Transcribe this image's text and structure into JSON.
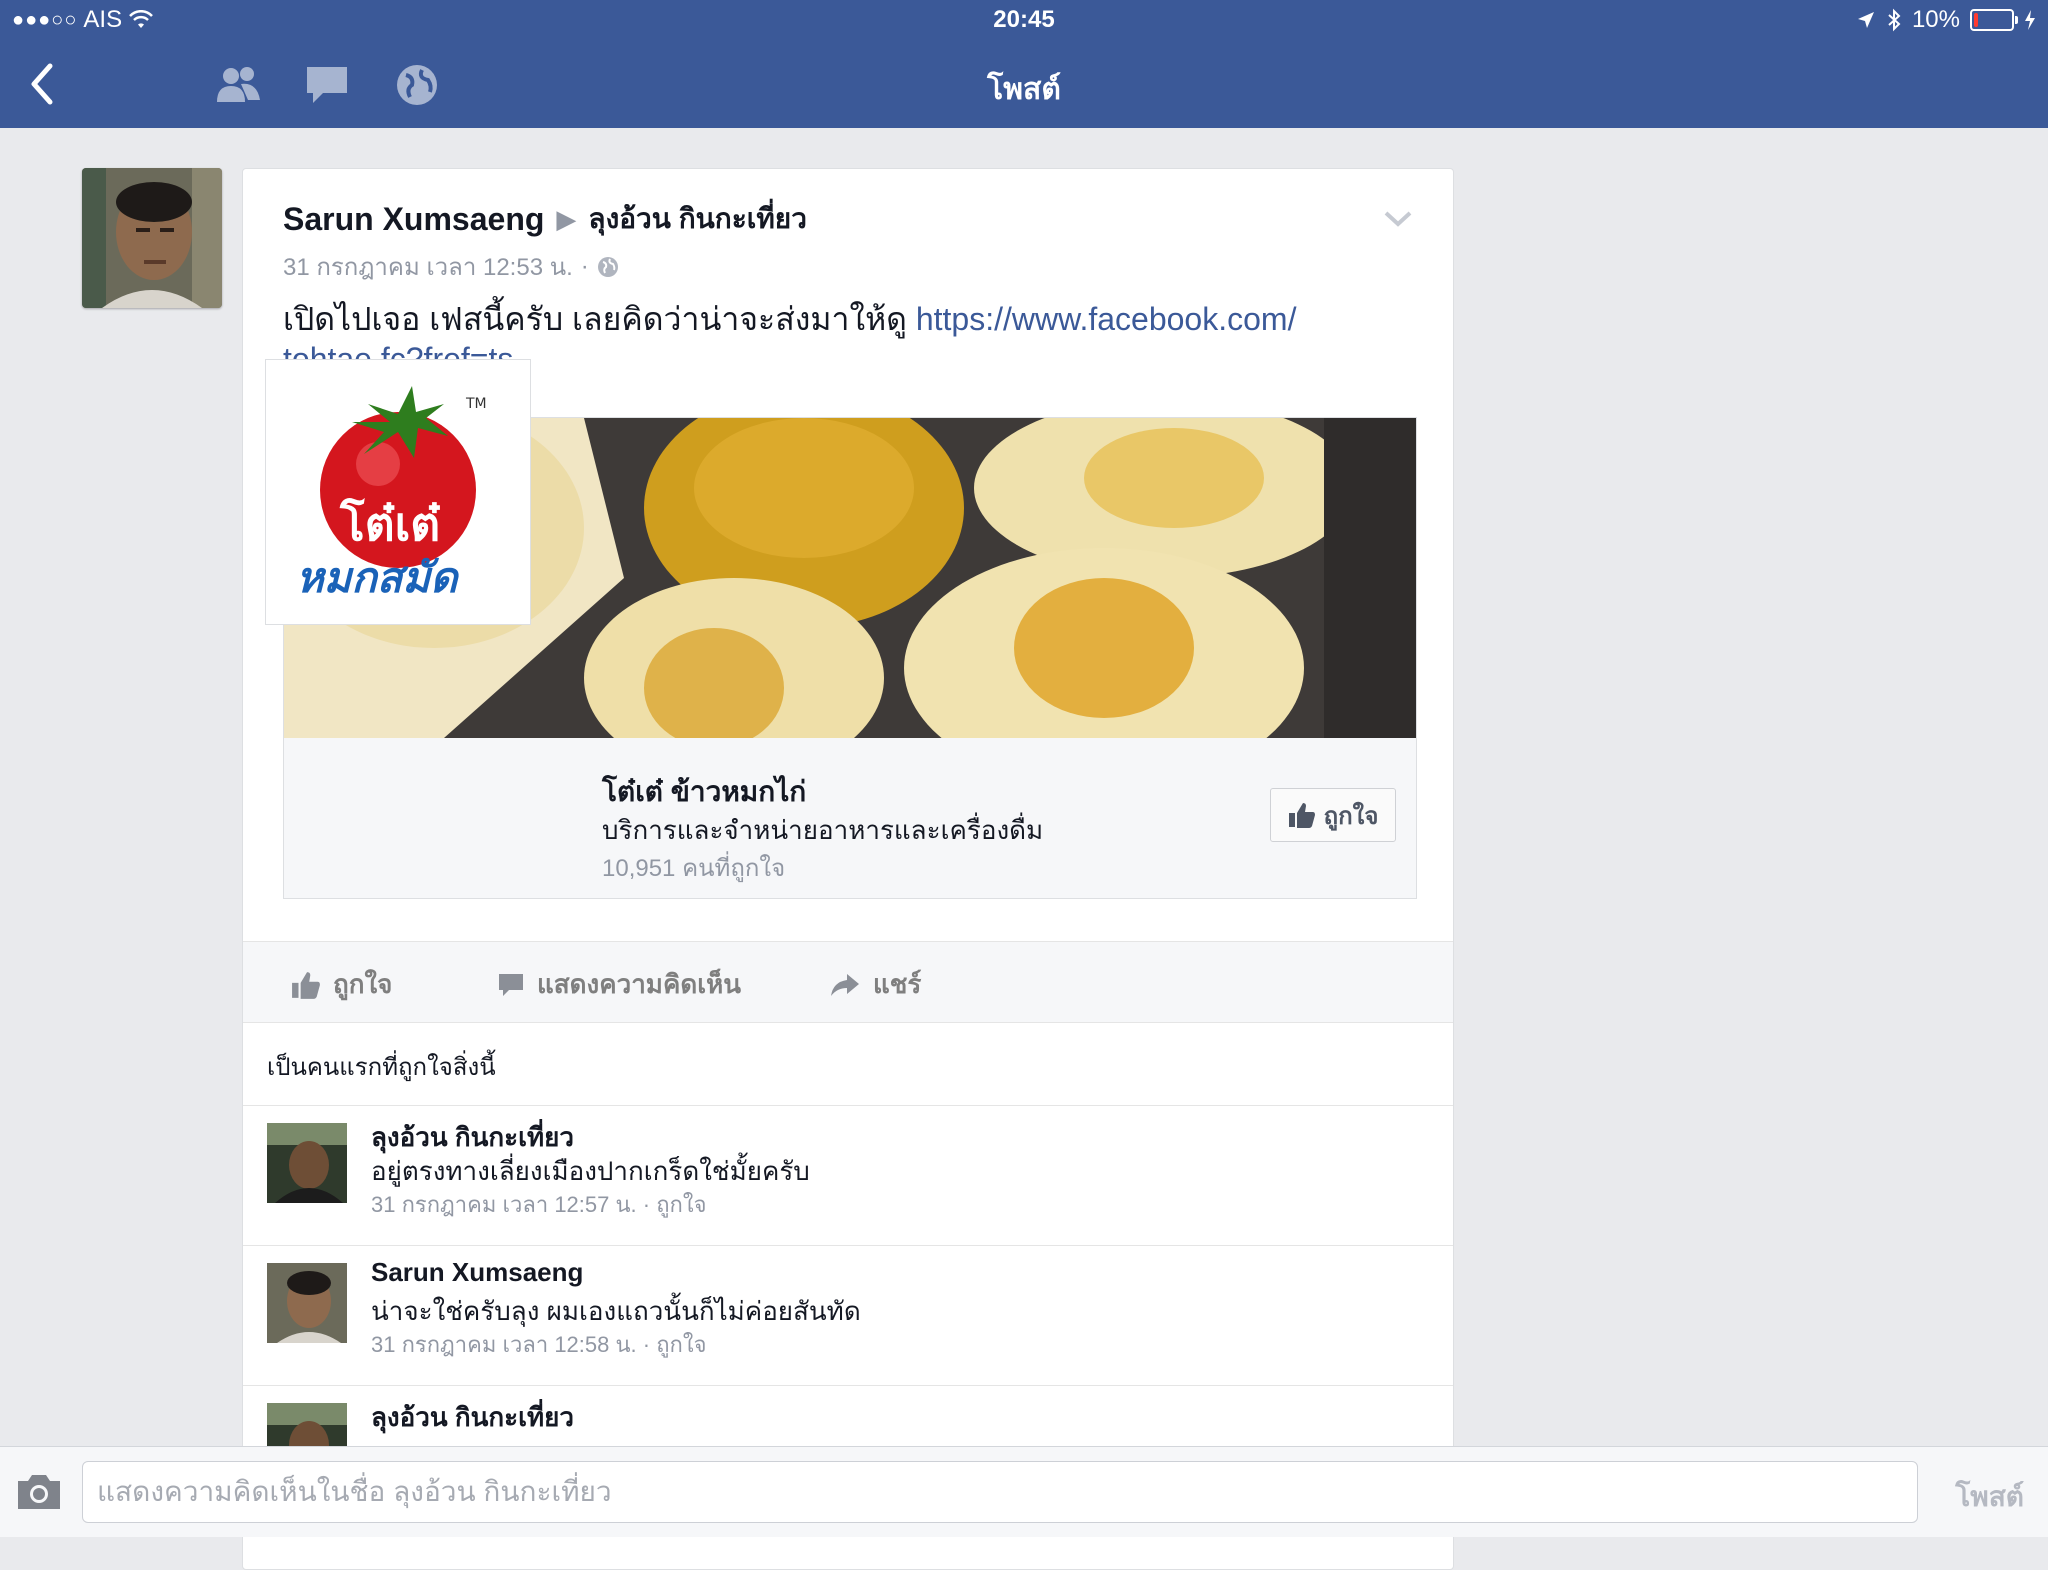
{
  "status_bar": {
    "signal": "●●●○○",
    "carrier": "AIS",
    "time": "20:45",
    "battery": "10%",
    "battery_level": 0.1
  },
  "nav": {
    "title": "โพสต์",
    "icons": [
      "back-arrow-icon",
      "friends-icon",
      "messages-icon",
      "globe-icon"
    ]
  },
  "post": {
    "author": "Sarun Xumsaeng",
    "separator": "▶",
    "target": "ลุงอ้วน กินกะเที่ยว",
    "timestamp": "31 กรกฎาคม เวลา 12:53 น.",
    "dot": "·",
    "text": "เปิดไปเจอ เฟสนี้ครับ เลยคิดว่าน่าจะส่งมาให้ดู ",
    "link_line1": "https://www.facebook.com/",
    "link_line2": "tohtae.fc?fref=ts"
  },
  "link_preview": {
    "page_name": "โต๋เต๋ ข้าวหมกไก่",
    "category": "บริการและจำหน่ายอาหารและเครื่องดื่ม",
    "likes": "10,951 คนที่ถูกใจ",
    "like_button": "ถูกใจ",
    "logo_text_top": "โต๋เต๋",
    "logo_text_bottom": "หมกสมัด",
    "logo_tm": "TM"
  },
  "actions": {
    "like": "ถูกใจ",
    "comment": "แสดงความคิดเห็น",
    "share": "แชร์"
  },
  "first_like": "เป็นคนแรกที่ถูกใจสิ่งนี้",
  "comments": [
    {
      "name": "ลุงอ้วน กินกะเที่ยว",
      "text": "อยู่ตรงทางเลี่ยงเมืองปากเกร็ดใช่มั้ยครับ",
      "time": "31 กรกฎาคม เวลา 12:57 น.",
      "sep": " · ",
      "like": "ถูกใจ"
    },
    {
      "name": "Sarun Xumsaeng",
      "text": "น่าจะใช่ครับลุง ผมเองแถวนั้นก็ไม่ค่อยสันทัด",
      "time": "31 กรกฎาคม เวลา 12:58 น.",
      "sep": " · ",
      "like": "ถูกใจ"
    },
    {
      "name": "ลุงอ้วน กินกะเที่ยว"
    }
  ],
  "composer": {
    "placeholder": "แสดงความคิดเห็นในชื่อ ลุงอ้วน กินกะเที่ยว",
    "post_button": "โพสต์"
  }
}
